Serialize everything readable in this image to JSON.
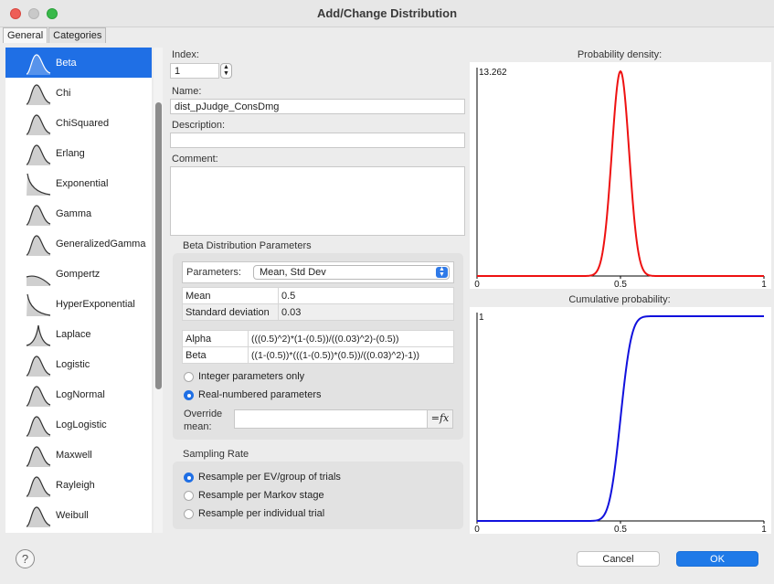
{
  "window": {
    "title": "Add/Change Distribution"
  },
  "tabs": [
    "General",
    "Categories"
  ],
  "distributions": [
    "Beta",
    "Chi",
    "ChiSquared",
    "Erlang",
    "Exponential",
    "Gamma",
    "GeneralizedGamma",
    "Gompertz",
    "HyperExponential",
    "Laplace",
    "Logistic",
    "LogNormal",
    "LogLogistic",
    "Maxwell",
    "Rayleigh",
    "Weibull"
  ],
  "selected_distribution": "Beta",
  "form": {
    "index_label": "Index:",
    "index_value": "1",
    "name_label": "Name:",
    "name_value": "dist_pJudge_ConsDmg",
    "description_label": "Description:",
    "description_value": "",
    "comment_label": "Comment:",
    "comment_value": ""
  },
  "beta_params": {
    "title": "Beta Distribution Parameters",
    "parameters_label": "Parameters:",
    "parameters_value": "Mean, Std Dev",
    "rows": [
      {
        "name": "Mean",
        "value": "0.5"
      },
      {
        "name": "Standard deviation",
        "value": "0.03"
      }
    ],
    "derived": [
      {
        "name": "Alpha",
        "value": "(((0.5)^2)*(1-(0.5))/((0.03)^2)-(0.5))"
      },
      {
        "name": "Beta",
        "value": "((1-(0.5))*(((1-(0.5))*(0.5))/((0.03)^2)-1))"
      }
    ],
    "integer_option": "Integer parameters only",
    "real_option": "Real-numbered parameters",
    "override_label_1": "Override",
    "override_label_2": "mean:",
    "override_value": "",
    "fx_label": "=fx"
  },
  "sampling": {
    "title": "Sampling Rate",
    "options": [
      "Resample per EV/group of trials",
      "Resample per Markov stage",
      "Resample per individual trial"
    ],
    "selected": 0
  },
  "charts": {
    "density_title": "Probability density:",
    "cumulative_title": "Cumulative probability:"
  },
  "chart_data": [
    {
      "type": "line",
      "title": "Probability density:",
      "x_ticks": [
        "0",
        "0.5",
        "1"
      ],
      "y_max_label": "13.262",
      "xlim": [
        0,
        1
      ],
      "ylim": [
        0,
        13.262
      ],
      "distribution": {
        "family": "beta",
        "mean": 0.5,
        "sd": 0.03
      },
      "series": [
        {
          "color": "#ee1111"
        }
      ]
    },
    {
      "type": "line",
      "title": "Cumulative probability:",
      "x_ticks": [
        "0",
        "0.5",
        "1"
      ],
      "y_max_label": "1",
      "xlim": [
        0,
        1
      ],
      "ylim": [
        0,
        1
      ],
      "distribution": {
        "family": "beta",
        "mean": 0.5,
        "sd": 0.03
      },
      "series": [
        {
          "color": "#1111dd"
        }
      ]
    }
  ],
  "buttons": {
    "cancel": "Cancel",
    "ok": "OK",
    "help": "?"
  }
}
